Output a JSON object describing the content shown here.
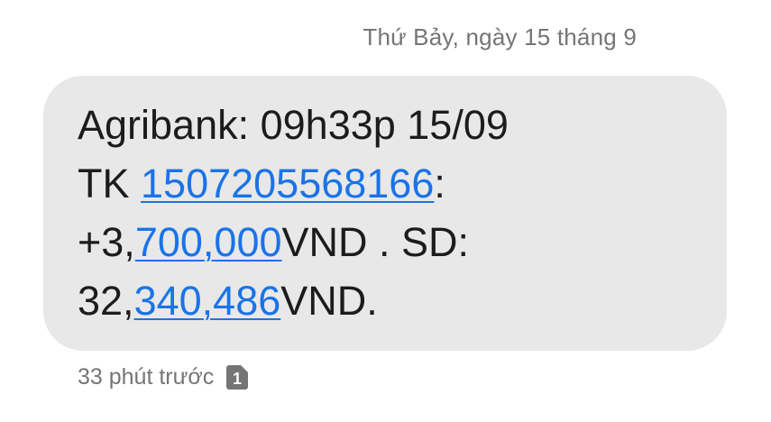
{
  "header": {
    "date": "Thứ Bảy, ngày 15 tháng 9"
  },
  "message": {
    "line1": "Agribank: 09h33p 15/09",
    "line2_prefix": "TK ",
    "account_number": "1507205568166",
    "line2_suffix": ":",
    "line3_prefix": "+3,",
    "amount_part1": "700",
    "amount_comma": ",",
    "amount_part2": "000",
    "line3_suffix": "VND . SD:",
    "line4_prefix": "32,",
    "balance_part1": "340",
    "balance_comma": ",",
    "balance_part2": "486",
    "line4_suffix": "VND."
  },
  "meta": {
    "timestamp": "33 phút trước",
    "sim_slot": "1",
    "sim_icon": "sim-1-icon"
  },
  "colors": {
    "bubble_bg": "#e8e8e8",
    "link": "#1a73e8",
    "text": "#1c1c1c",
    "muted": "#757575"
  }
}
